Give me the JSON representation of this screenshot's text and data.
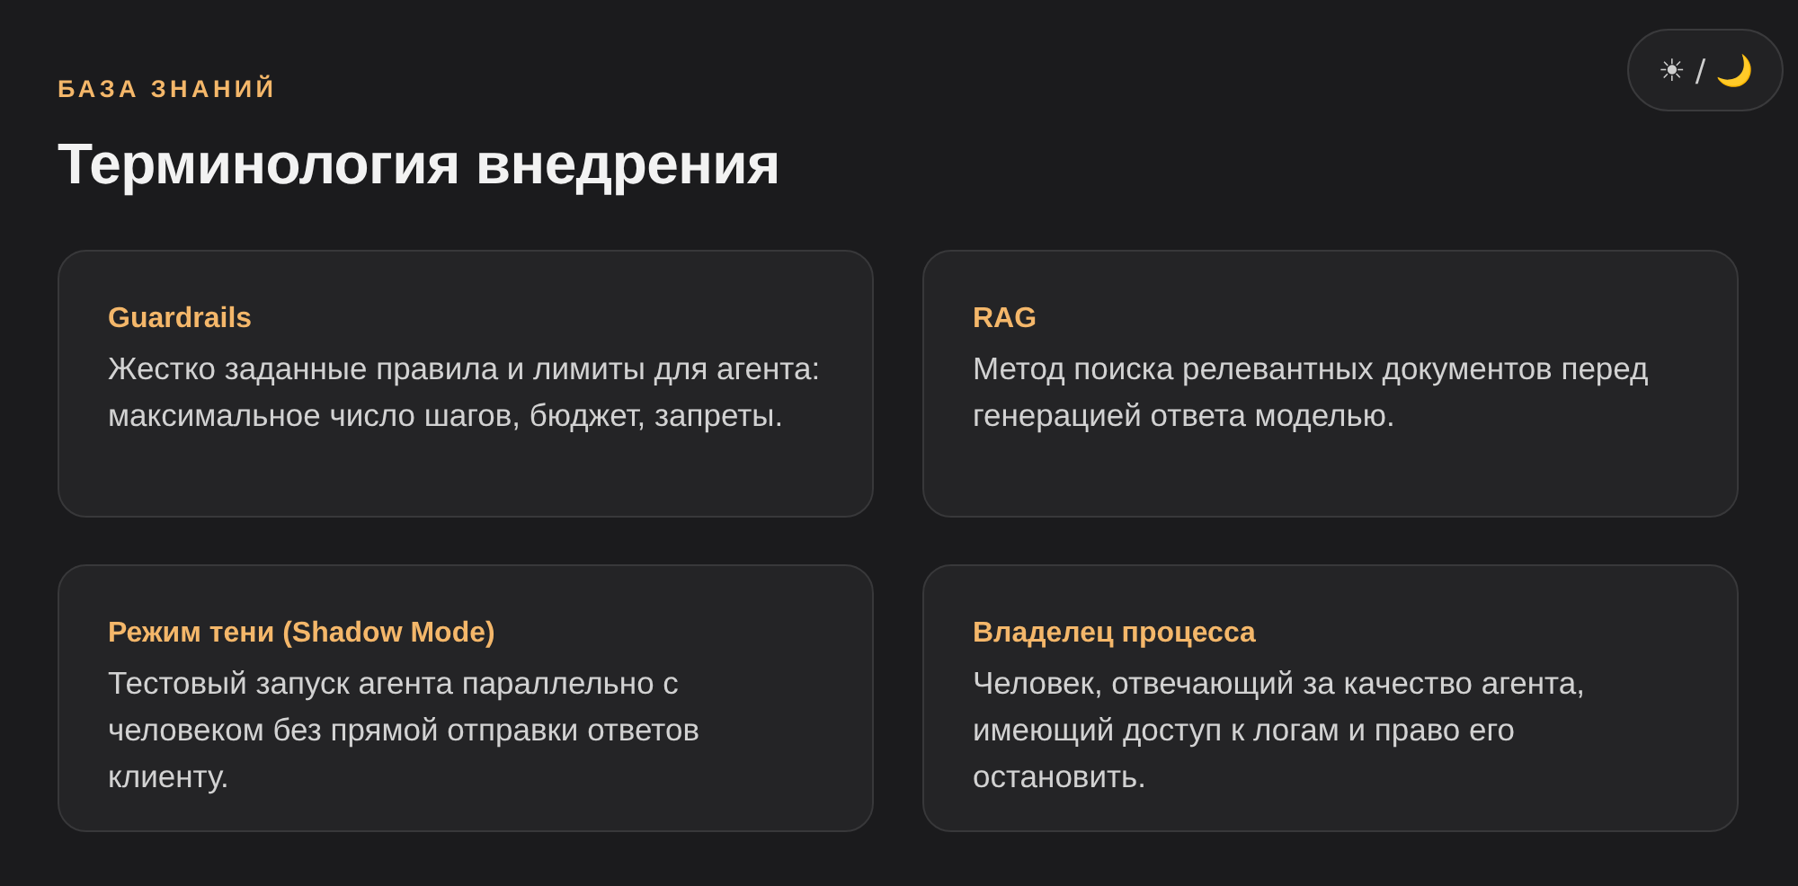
{
  "theme_toggle": {
    "label": "☀ / 🌙"
  },
  "eyebrow": "БАЗА ЗНАНИЙ",
  "title": "Терминология внедрения",
  "cards": [
    {
      "term": "Guardrails",
      "description": "Жестко заданные правила и лимиты для агента: максимальное число шагов, бюджет, запреты."
    },
    {
      "term": "RAG",
      "description": "Метод поиска релевантных документов перед генерацией ответа моделью."
    },
    {
      "term": "Режим тени (Shadow Mode)",
      "description": "Тестовый запуск агента параллельно с человеком без прямой отправки ответов клиенту."
    },
    {
      "term": "Владелец процесса",
      "description": "Человек, отвечающий за качество агента, имеющий доступ к логам и право его остановить."
    }
  ]
}
